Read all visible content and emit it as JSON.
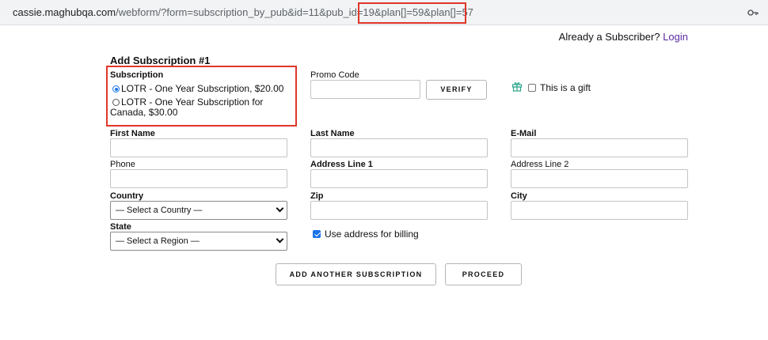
{
  "browser": {
    "url_host": "cassie.maghubqa.com",
    "url_path": "/webform/?form=subscription_by_pub&id=11&pub_id=19&plan[]=59&plan[]=57",
    "key_icon": "key-icon"
  },
  "header": {
    "already_subscriber": "Already a Subscriber?",
    "login_link": "Login"
  },
  "form": {
    "title": "Add Subscription #1",
    "subscription": {
      "label": "Subscription",
      "options": [
        {
          "label": "LOTR - One Year Subscription, $20.00",
          "selected": true
        },
        {
          "label_line1": "LOTR - One Year Subscription for",
          "label_line2": "Canada, $30.00",
          "selected": false
        }
      ]
    },
    "promo": {
      "label": "Promo Code",
      "value": "",
      "verify_label": "VERIFY"
    },
    "gift": {
      "icon": "gift-icon",
      "label": "This is a gift",
      "checked": false
    },
    "fields": {
      "first_name": {
        "label": "First Name",
        "value": ""
      },
      "last_name": {
        "label": "Last Name",
        "value": ""
      },
      "email": {
        "label": "E-Mail",
        "value": ""
      },
      "phone": {
        "label": "Phone",
        "value": ""
      },
      "address1": {
        "label": "Address Line 1",
        "value": ""
      },
      "address2": {
        "label": "Address Line 2",
        "value": ""
      },
      "country": {
        "label": "Country",
        "selected": "— Select a Country —"
      },
      "zip": {
        "label": "Zip",
        "value": ""
      },
      "city": {
        "label": "City",
        "value": ""
      },
      "state": {
        "label": "State",
        "selected": "— Select a Region —"
      }
    },
    "billing": {
      "label": "Use address for billing",
      "checked": true
    },
    "actions": {
      "add_another": "ADD ANOTHER SUBSCRIPTION",
      "proceed": "PROCEED"
    }
  },
  "colors": {
    "highlight": "#e0362a",
    "link": "#5a2ca0",
    "accent": "#1a73e8",
    "gift": "#2aa58a"
  }
}
